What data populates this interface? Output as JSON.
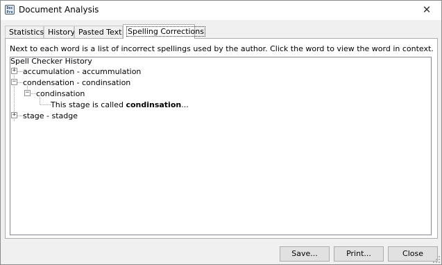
{
  "window": {
    "title": "Document Analysis",
    "icon_text": "Doc Pro",
    "close_glyph": "✕"
  },
  "tabs": [
    {
      "label": "Statistics",
      "active": false
    },
    {
      "label": "History",
      "active": false
    },
    {
      "label": "Pasted Text",
      "active": false
    },
    {
      "label": "Spelling Corrections",
      "active": true
    }
  ],
  "panel": {
    "description": "Next to each word is a list of incorrect spellings used by the author. Click the word to view the word in context."
  },
  "tree": {
    "root": "Spell Checker History",
    "items": [
      {
        "label": "accumulation - accummulation",
        "expanded": false
      },
      {
        "label": "condensation - condinsation",
        "expanded": true,
        "child": {
          "label": "condinsation",
          "expanded": true,
          "context_before": "This stage is called ",
          "context_bold": "condinsation",
          "context_after": "..."
        }
      },
      {
        "label": "stage - stadge",
        "expanded": false
      }
    ],
    "expander_collapsed": "+",
    "expander_expanded": "−"
  },
  "buttons": {
    "save": "Save...",
    "print": "Print...",
    "close": "Close"
  }
}
